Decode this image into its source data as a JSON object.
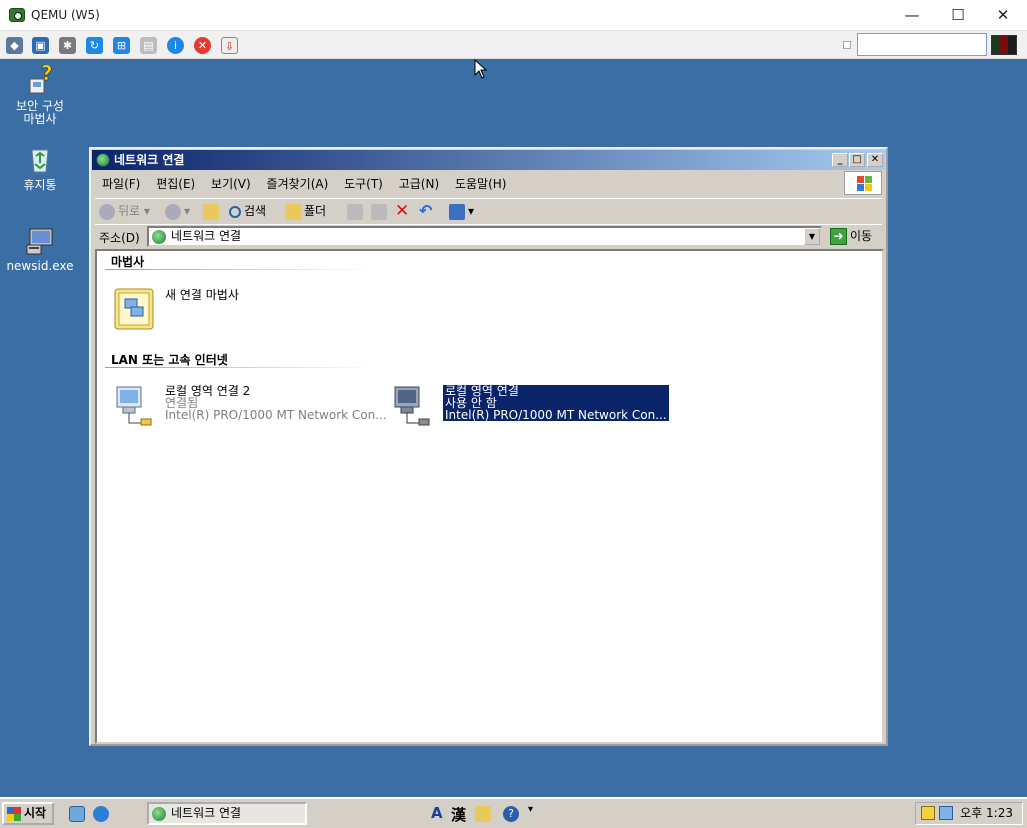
{
  "host": {
    "title": "QEMU (W5)",
    "controls": {
      "minimize": "—",
      "maximize": "☐",
      "close": "✕"
    },
    "search_value": ""
  },
  "desktop": {
    "icons": [
      {
        "label": "보안 구성 마법사",
        "icon": "security-wizard-icon"
      },
      {
        "label": "휴지통",
        "icon": "recycle-bin-icon"
      },
      {
        "label": "newsid.exe",
        "icon": "computer-icon"
      }
    ]
  },
  "window": {
    "title": "네트워크 연결",
    "menu": [
      "파일(F)",
      "편집(E)",
      "보기(V)",
      "즐겨찾기(A)",
      "도구(T)",
      "고급(N)",
      "도움말(H)"
    ],
    "toolbar": {
      "back": "뒤로",
      "search": "검색",
      "folders": "폴더"
    },
    "address": {
      "label": "주소(D)",
      "value": "네트워크 연결",
      "go": "이동"
    },
    "groups": [
      {
        "title": "마법사",
        "items": [
          {
            "name": "새 연결 마법사"
          }
        ]
      },
      {
        "title": "LAN 또는 고속 인터넷",
        "items": [
          {
            "name": "로컬 영역 연결 2",
            "status": "연결됨",
            "device": "Intel(R) PRO/1000 MT Network Con..."
          },
          {
            "name": "로컬 영역 연결",
            "status": "사용 안 함",
            "device": "Intel(R) PRO/1000 MT Network Con..."
          }
        ]
      }
    ]
  },
  "taskbar": {
    "start": "시작",
    "task": "네트워크 연결",
    "ime": {
      "a": "A",
      "han": "漢"
    },
    "clock": "오후 1:23"
  }
}
